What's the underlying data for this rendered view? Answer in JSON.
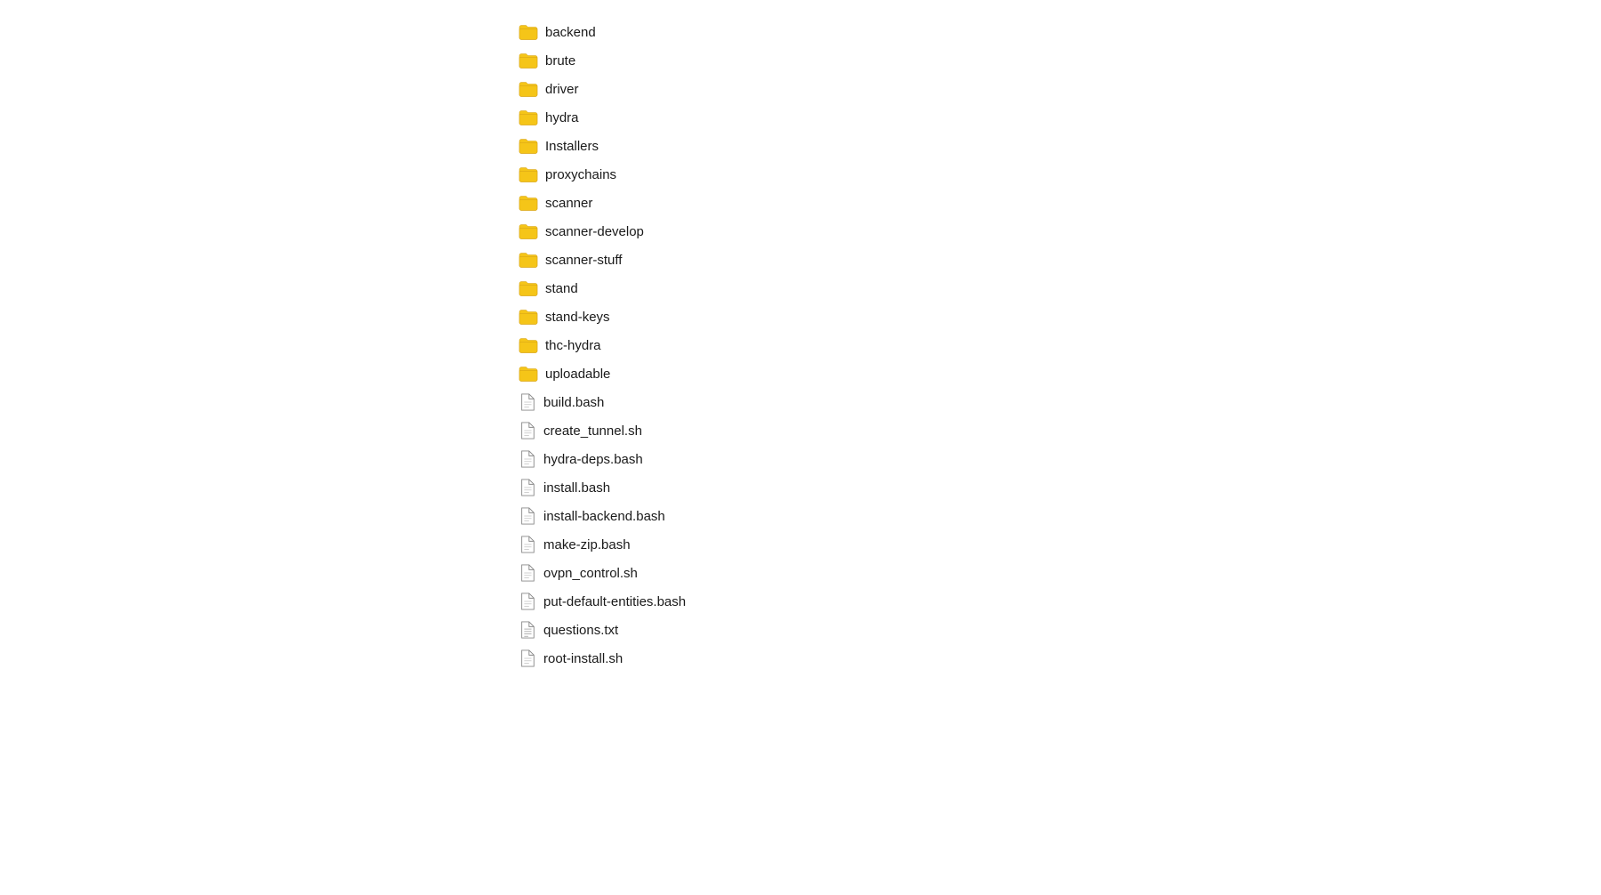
{
  "fileList": {
    "items": [
      {
        "id": "backend",
        "name": "backend",
        "type": "folder"
      },
      {
        "id": "brute",
        "name": "brute",
        "type": "folder"
      },
      {
        "id": "driver",
        "name": "driver",
        "type": "folder"
      },
      {
        "id": "hydra",
        "name": "hydra",
        "type": "folder"
      },
      {
        "id": "Installers",
        "name": "Installers",
        "type": "folder"
      },
      {
        "id": "proxychains",
        "name": "proxychains",
        "type": "folder"
      },
      {
        "id": "scanner",
        "name": "scanner",
        "type": "folder"
      },
      {
        "id": "scanner-develop",
        "name": "scanner-develop",
        "type": "folder"
      },
      {
        "id": "scanner-stuff",
        "name": "scanner-stuff",
        "type": "folder"
      },
      {
        "id": "stand",
        "name": "stand",
        "type": "folder"
      },
      {
        "id": "stand-keys",
        "name": "stand-keys",
        "type": "folder"
      },
      {
        "id": "thc-hydra",
        "name": "thc-hydra",
        "type": "folder"
      },
      {
        "id": "uploadable",
        "name": "uploadable",
        "type": "folder"
      },
      {
        "id": "build.bash",
        "name": "build.bash",
        "type": "file"
      },
      {
        "id": "create_tunnel.sh",
        "name": "create_tunnel.sh",
        "type": "file"
      },
      {
        "id": "hydra-deps.bash",
        "name": "hydra-deps.bash",
        "type": "file"
      },
      {
        "id": "install.bash",
        "name": "install.bash",
        "type": "file"
      },
      {
        "id": "install-backend.bash",
        "name": "install-backend.bash",
        "type": "file"
      },
      {
        "id": "make-zip.bash",
        "name": "make-zip.bash",
        "type": "file"
      },
      {
        "id": "ovpn_control.sh",
        "name": "ovpn_control.sh",
        "type": "file"
      },
      {
        "id": "put-default-entities.bash",
        "name": "put-default-entities.bash",
        "type": "file"
      },
      {
        "id": "questions.txt",
        "name": "questions.txt",
        "type": "txt"
      },
      {
        "id": "root-install.sh",
        "name": "root-install.sh",
        "type": "file"
      }
    ]
  },
  "colors": {
    "folderYellow": "#f5c518",
    "folderBody": "#f5c518",
    "fileWhite": "#ffffff",
    "fileStroke": "#888888"
  }
}
